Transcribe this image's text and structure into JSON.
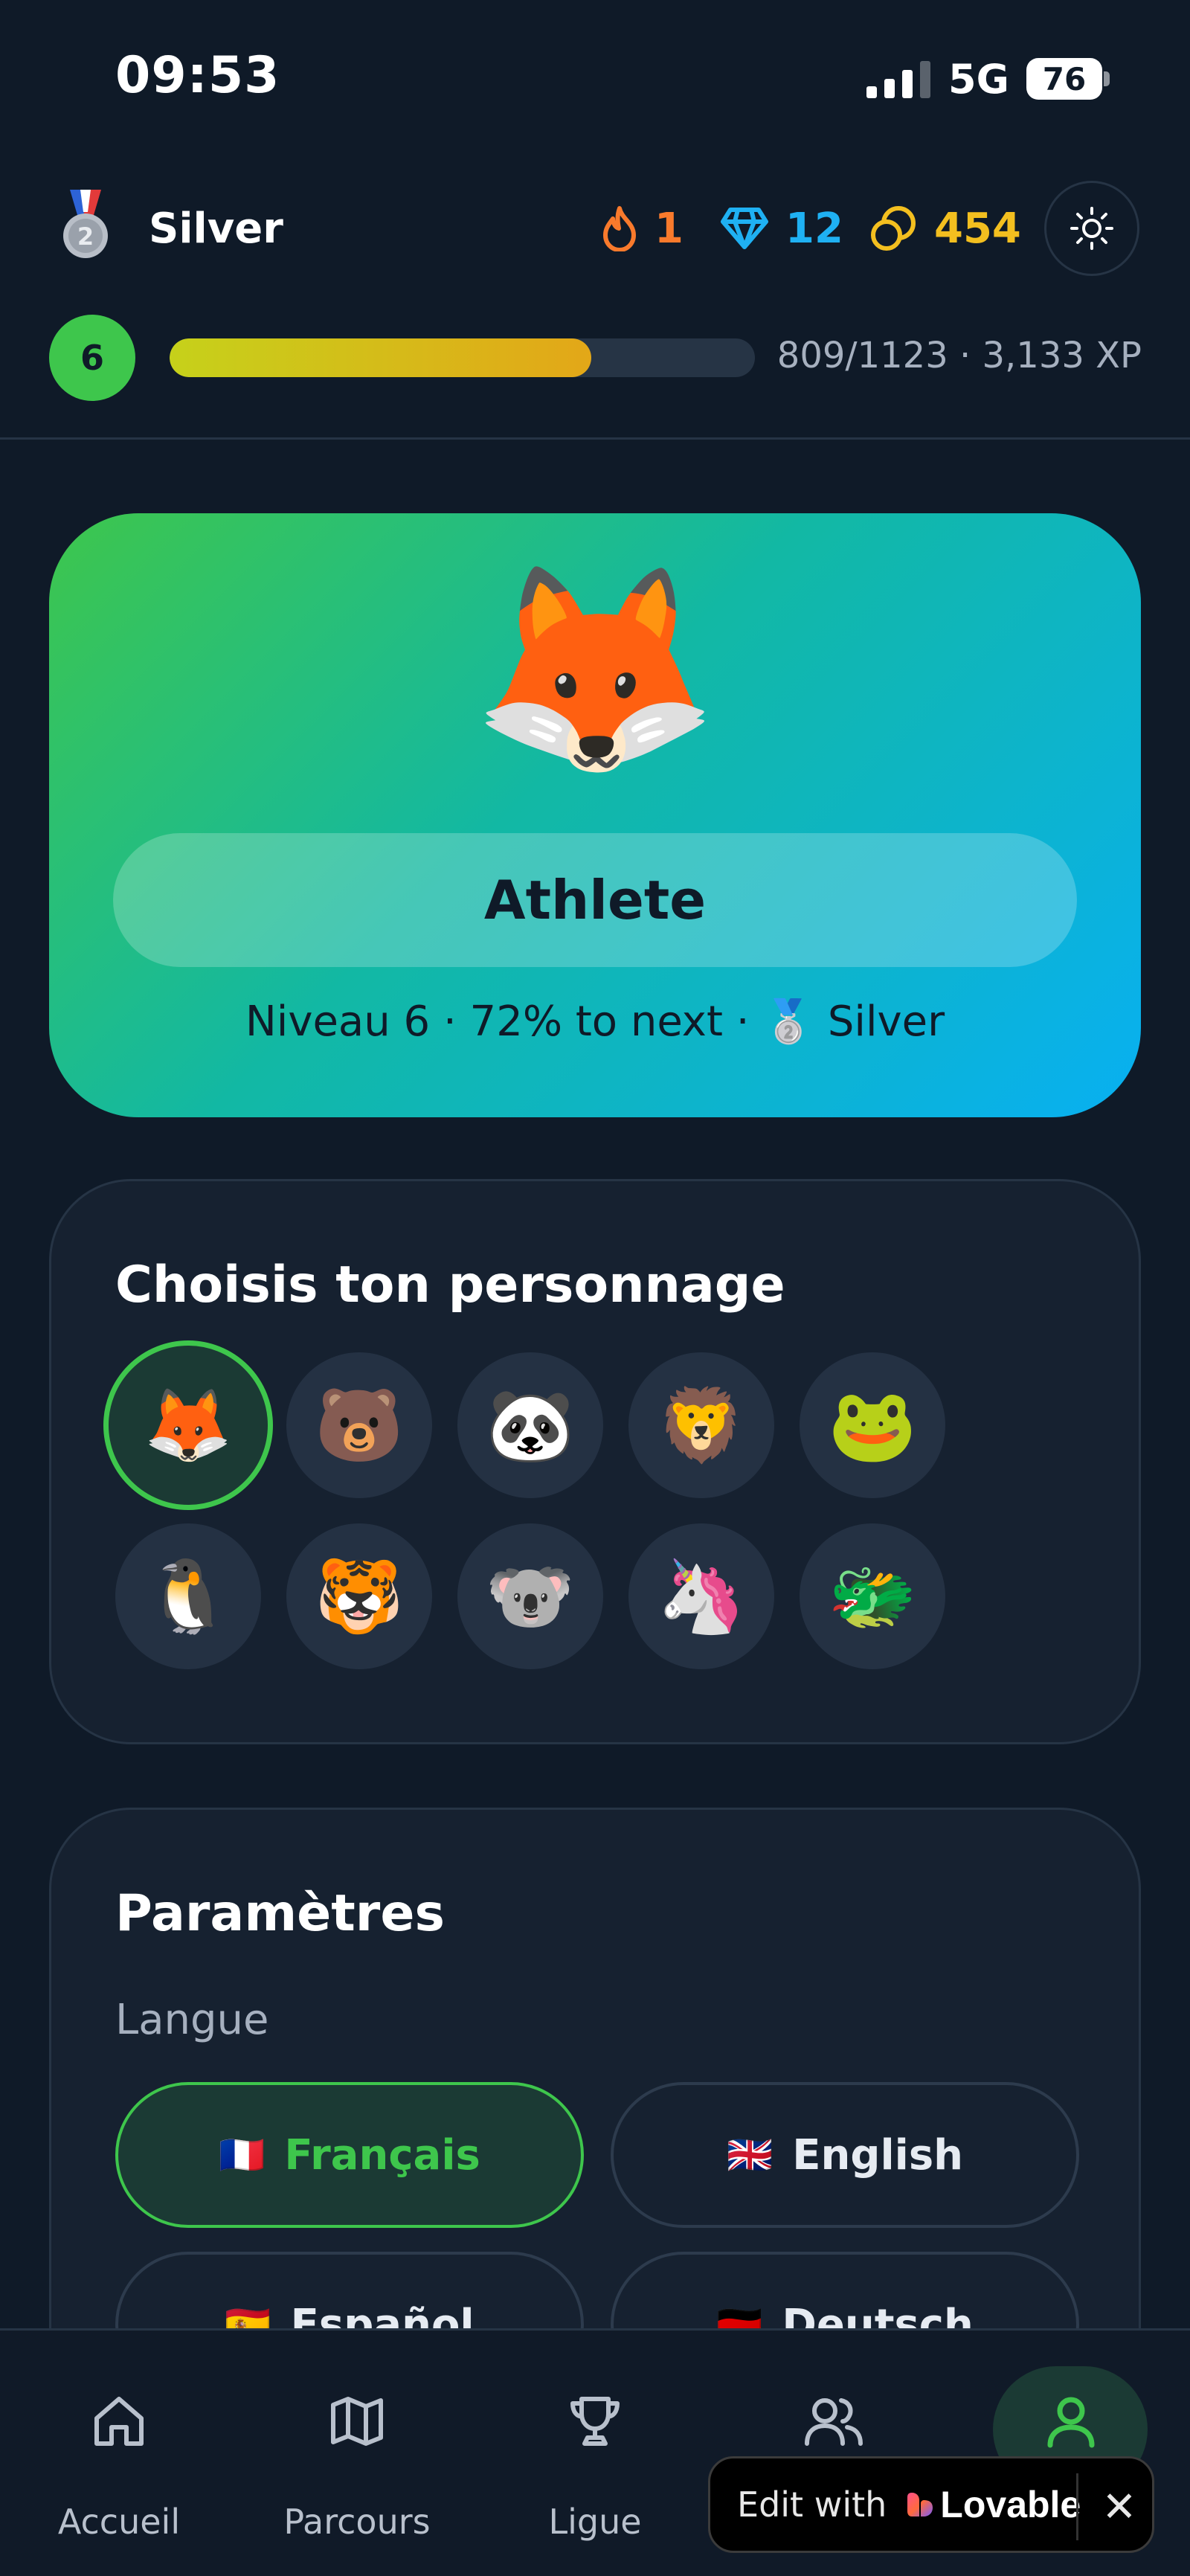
{
  "status_bar": {
    "time": "09:53",
    "network": "5G",
    "battery": "76"
  },
  "header": {
    "league": "Silver",
    "streak": "1",
    "gems": "12",
    "coins": "454",
    "icons": {
      "medal": "silver-medal-icon",
      "streak": "flame-icon",
      "gems": "gem-icon",
      "coins": "coins-icon",
      "theme": "sun-icon"
    }
  },
  "level": {
    "number": "6",
    "xp_text": "809/1123 · 3,133 XP",
    "progress_fraction": 0.72
  },
  "hero": {
    "avatar": "🦊",
    "title": "Athlete",
    "subtitle": "Niveau 6 · 72% to next · 🥈 Silver"
  },
  "characters": {
    "title": "Choisis ton personnage",
    "items": [
      "🦊",
      "🐻",
      "🐼",
      "🦁",
      "🐸",
      "🐧",
      "🐯",
      "🐨",
      "🦄",
      "🐲"
    ],
    "selected_index": 0
  },
  "settings": {
    "title": "Paramètres",
    "language_label": "Langue",
    "languages": [
      {
        "flag": "🇫🇷",
        "label": "Français",
        "selected": true
      },
      {
        "flag": "🇬🇧",
        "label": "English",
        "selected": false
      },
      {
        "flag": "🇪🇸",
        "label": "Español",
        "selected": false
      },
      {
        "flag": "🇩🇪",
        "label": "Deutsch",
        "selected": false
      }
    ]
  },
  "nav": {
    "items": [
      {
        "label": "Accueil",
        "icon": "home-icon"
      },
      {
        "label": "Parcours",
        "icon": "map-icon"
      },
      {
        "label": "Ligue",
        "icon": "trophy-icon"
      },
      {
        "label": "",
        "icon": "users-icon"
      },
      {
        "label": "",
        "icon": "profile-icon"
      }
    ],
    "active_index": 4
  },
  "lovable_badge": {
    "text": "Edit with",
    "brand": "Lovable",
    "close": "✕"
  },
  "colors": {
    "accent_green": "#3ec64c",
    "background": "#0f1a28",
    "card": "#162130"
  }
}
